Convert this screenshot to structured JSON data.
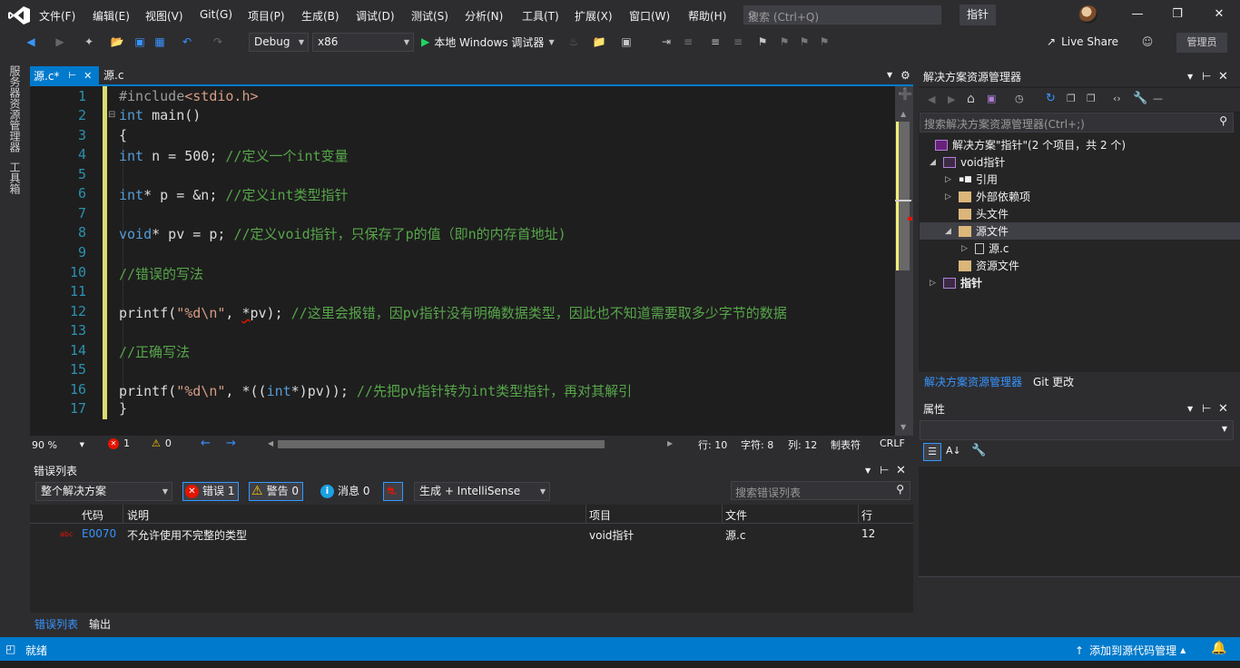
{
  "menu": [
    "文件(F)",
    "编辑(E)",
    "视图(V)",
    "Git(G)",
    "项目(P)",
    "生成(B)",
    "调试(D)",
    "测试(S)",
    "分析(N)",
    "工具(T)",
    "扩展(X)",
    "窗口(W)",
    "帮助(H)"
  ],
  "search_placeholder": "搜索 (Ctrl+Q)",
  "solution_title": "指针",
  "toolbar": {
    "config": "Debug",
    "platform": "x86",
    "run_label": "本地 Windows 调试器",
    "live_share": "Live Share",
    "admin": "管理员"
  },
  "left_strip": [
    "服务器资源管理器",
    "工具箱"
  ],
  "tabs": {
    "active": "源.c*",
    "inactive": "源.c"
  },
  "line_numbers": [
    "1",
    "2",
    "3",
    "4",
    "5",
    "6",
    "7",
    "8",
    "9",
    "10",
    "11",
    "12",
    "13",
    "14",
    "15",
    "16",
    "17"
  ],
  "code": {
    "l1_pp": "#include",
    "l1_hdr": "<stdio.h>",
    "l2_kw": "int",
    "l2_rest": " main()",
    "l3": "{",
    "l4_kw": "int",
    "l4_rest": " n = 500; ",
    "l4_cm": "//定义一个int变量",
    "l6_kw": "int",
    "l6_rest": "* p = &n; ",
    "l6_cm": "//定义int类型指针",
    "l8_kw": "void",
    "l8_rest": "* pv = p; ",
    "l8_cm": "//定义void指针，只保存了p的值（即n的内存首地址)",
    "l10_cm": "//错误的写法",
    "l12_fn": "printf",
    "l12_a": "(",
    "l12_st": "\"%d\\n\"",
    "l12_b": ", ",
    "l12_err": "*",
    "l12_c": "pv); ",
    "l12_cm": "//这里会报错，因pv指针没有明确数据类型，因此也不知道需要取多少字节的数据",
    "l14_cm": "//正确写法",
    "l16_fn": "printf",
    "l16_a": "(",
    "l16_st": "\"%d\\n\"",
    "l16_b": ", *((",
    "l16_kw": "int",
    "l16_c": "*)pv)); ",
    "l16_cm": "//先把pv指针转为int类型指针，再对其解引",
    "l17": "}"
  },
  "editor_status": {
    "zoom": "90 %",
    "errors": "1",
    "warnings": "0",
    "row": "行: 10",
    "char": "字符: 8",
    "col": "列: 12",
    "tab": "制表符",
    "eol": "CRLF"
  },
  "error_list": {
    "title": "错误列表",
    "scope": "整个解决方案",
    "errors_btn": "错误 1",
    "warnings_btn": "警告 0",
    "messages_btn": "消息 0",
    "build_filter": "生成 + IntelliSense",
    "search_placeholder": "搜索错误列表",
    "columns": [
      "代码",
      "说明",
      "项目",
      "文件",
      "行"
    ],
    "rows": [
      {
        "code": "E0070",
        "desc": "不允许使用不完整的类型",
        "project": "void指针",
        "file": "源.c",
        "line": "12"
      }
    ]
  },
  "bottom_tabs": [
    "错误列表",
    "输出"
  ],
  "solution_explorer": {
    "title": "解决方案资源管理器",
    "search_placeholder": "搜索解决方案资源管理器(Ctrl+;)",
    "tree": [
      {
        "label": "解决方案\"指针\"(2 个项目，共 2 个)",
        "bold": false
      },
      {
        "label": "void指针",
        "bold": false
      },
      {
        "label": "引用",
        "bold": false
      },
      {
        "label": "外部依赖项",
        "bold": false
      },
      {
        "label": "头文件",
        "bold": false
      },
      {
        "label": "源文件",
        "bold": false
      },
      {
        "label": "源.c",
        "bold": false
      },
      {
        "label": "资源文件",
        "bold": false
      },
      {
        "label": "指针",
        "bold": true
      }
    ],
    "tabs": [
      "解决方案资源管理器",
      "Git 更改"
    ]
  },
  "properties": {
    "title": "属性"
  },
  "statusbar": {
    "ready": "就绪",
    "source_control": "添加到源代码管理"
  },
  "colors": {
    "accent": "#007acc",
    "background": "#1e1e1e",
    "keyword": "#569cd6",
    "comment": "#57a64a",
    "string": "#d69d85",
    "line_number": "#2b91af",
    "error": "#e51400"
  }
}
